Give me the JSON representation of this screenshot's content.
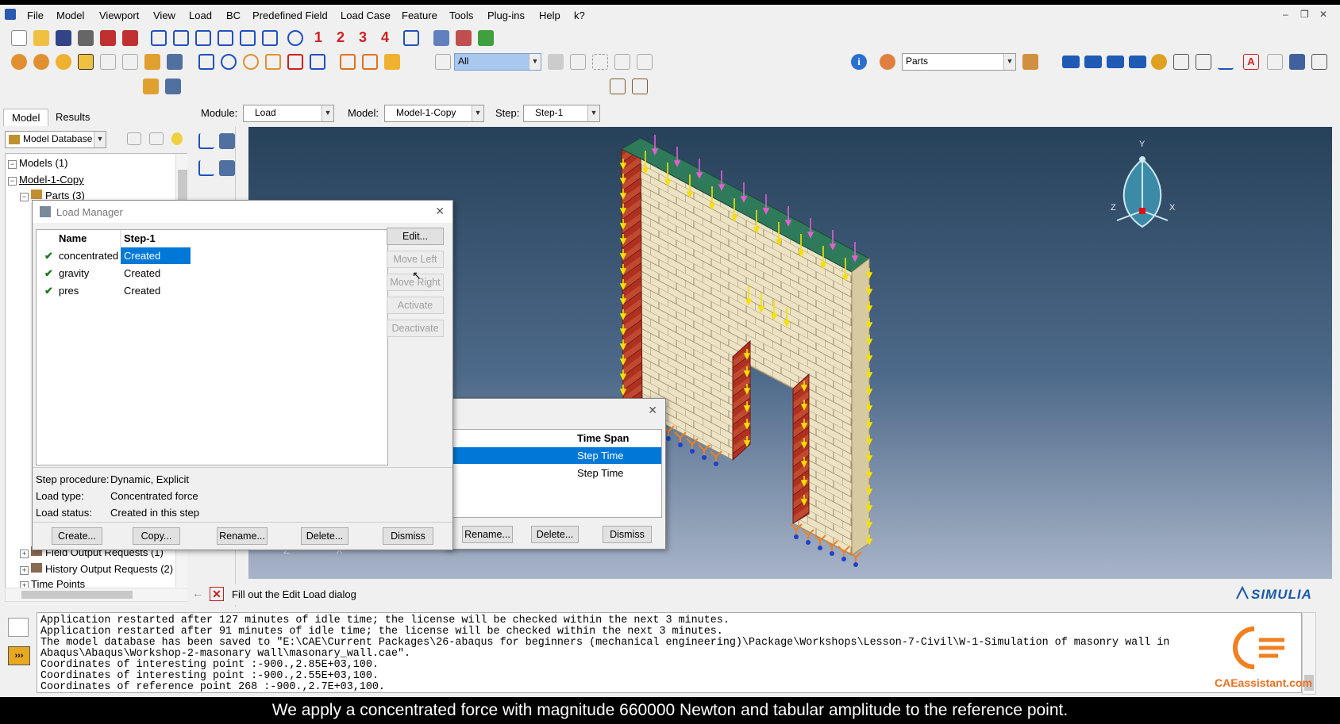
{
  "menu": {
    "items": [
      "File",
      "Model",
      "Viewport",
      "View",
      "Load",
      "BC",
      "Predefined Field",
      "Load Case",
      "Feature",
      "Tools",
      "Plug-ins",
      "Help",
      "k?"
    ]
  },
  "toolbar": {
    "numbers": [
      "1",
      "2",
      "3",
      "4"
    ],
    "selection_filter": "All",
    "render_selector": "Parts"
  },
  "context": {
    "module_label": "Module:",
    "module_value": "Load",
    "model_label": "Model:",
    "model_value": "Model-1-Copy",
    "step_label": "Step:",
    "step_value": "Step-1"
  },
  "left_panel": {
    "tabs": [
      "Model",
      "Results"
    ],
    "db_selector": "Model Database",
    "tree": [
      {
        "label": "Models (1)"
      },
      {
        "label": "Model-1-Copy"
      },
      {
        "label": "Parts (3)"
      },
      {
        "label": "Field Output Requests (1)"
      },
      {
        "label": "History Output Requests (2)"
      },
      {
        "label": "Time Points"
      }
    ]
  },
  "load_manager": {
    "title": "Load Manager",
    "columns": [
      "Name",
      "Step-1"
    ],
    "rows": [
      {
        "name": "concentrated",
        "status": "Created",
        "selected": true
      },
      {
        "name": "gravity",
        "status": "Created",
        "selected": false
      },
      {
        "name": "pres",
        "status": "Created",
        "selected": false
      }
    ],
    "side_buttons": [
      "Edit...",
      "Move Left",
      "Move Right",
      "Activate",
      "Deactivate"
    ],
    "info": [
      {
        "label": "Step procedure:",
        "value": "Dynamic, Explicit"
      },
      {
        "label": "Load type:",
        "value": "Concentrated force"
      },
      {
        "label": "Load status:",
        "value": "Created in this step"
      }
    ],
    "bottom_buttons": [
      "Create...",
      "Copy...",
      "Rename...",
      "Delete...",
      "Dismiss"
    ]
  },
  "amplitude_manager": {
    "column": "Time Span",
    "rows": [
      "Step Time",
      "Step Time"
    ],
    "bottom_buttons": [
      "Rename...",
      "Delete...",
      "Dismiss"
    ]
  },
  "prompt": {
    "text": "Fill out the Edit Load dialog"
  },
  "triad": {
    "y": "Y",
    "z": "Z",
    "x": "X"
  },
  "small_triad": {
    "z": "Z",
    "x": "X"
  },
  "brand": "SIMULIA",
  "console": {
    "lines": [
      "Application restarted after 127 minutes of idle time; the license will be checked within the next 3 minutes.",
      "Application restarted after 91 minutes of idle time; the license will be checked within the next 3 minutes.",
      "The model database has been saved to \"E:\\CAE\\Current Packages\\26-abaqus for beginners (mechanical engineering)\\Package\\Workshops\\Lesson-7-Civil\\W-1-Simulation of masonry wall in",
      "Abaqus\\Abaqus\\Workshop-2-masonary wall\\masonary_wall.cae\".",
      "Coordinates of interesting point :-900.,2.85E+03,100.",
      "Coordinates of interesting point :-900.,2.55E+03,100.",
      "Coordinates of reference point 268 :-900.,2.7E+03,100."
    ]
  },
  "watermark": "CAEassistant.com",
  "subtitle": "We apply a concentrated force with magnitude 660000 Newton and tabular amplitude to the reference point.",
  "colors": {
    "selection_blue": "#0078d7",
    "viewport_top": "#27415a",
    "viewport_bottom": "#a8b4c8",
    "brick_red": "#b03020",
    "brick_light": "#ece2c4",
    "load_yellow": "#f5e000",
    "pressure_pink": "#e060d0",
    "cap_green": "#2f7a5a",
    "check_green": "#1a7a1a"
  }
}
